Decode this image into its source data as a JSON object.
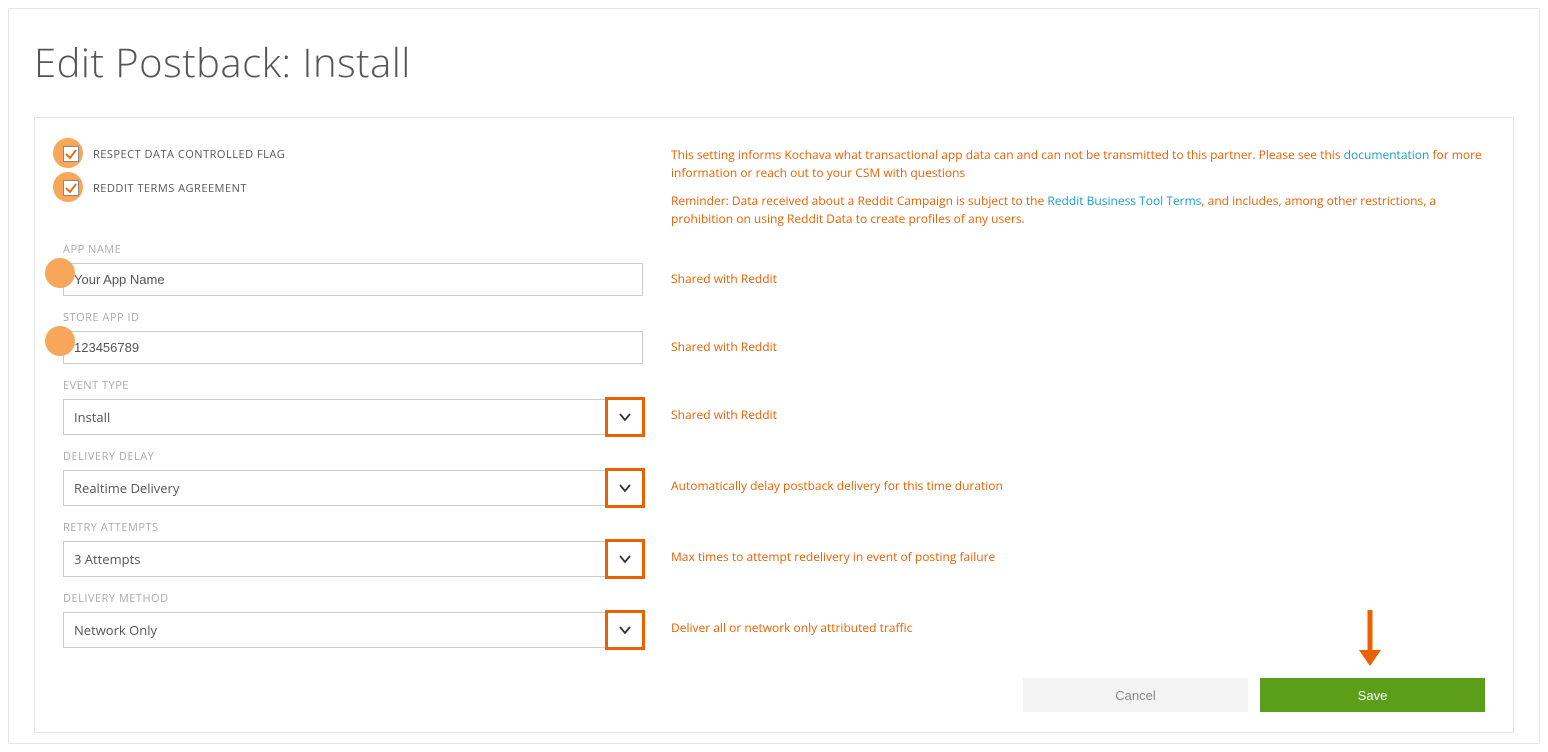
{
  "pageTitle": "Edit Postback: Install",
  "checkboxes": {
    "respect": {
      "label": "RESPECT DATA CONTROLLED FLAG",
      "checked": true
    },
    "terms": {
      "label": "REDDIT TERMS AGREEMENT",
      "checked": true
    }
  },
  "info": {
    "line1_pre": "This setting informs Kochava what transactional app data can and can not be transmitted to this partner. Please see this ",
    "line1_link": "documentation",
    "line1_post": " for more information or reach out to your CSM with questions",
    "line2_pre": "Reminder: Data received about a Reddit Campaign is subject to the ",
    "line2_link": "Reddit Business Tool Terms",
    "line2_post": ", and includes, among other restrictions, a prohibition on using Reddit Data to create profiles of any users."
  },
  "fields": {
    "appName": {
      "label": "APP NAME",
      "value": "Your App Name",
      "help": "Shared with Reddit"
    },
    "storeId": {
      "label": "STORE APP ID",
      "value": "123456789",
      "help": "Shared with Reddit"
    },
    "eventType": {
      "label": "EVENT TYPE",
      "value": "Install",
      "help": "Shared with Reddit"
    },
    "delay": {
      "label": "DELIVERY DELAY",
      "value": "Realtime Delivery",
      "help": "Automatically delay postback delivery for this time duration"
    },
    "retry": {
      "label": "RETRY ATTEMPTS",
      "value": "3 Attempts",
      "help": "Max times to attempt redelivery in event of posting failure"
    },
    "method": {
      "label": "DELIVERY METHOD",
      "value": "Network Only",
      "help": "Deliver all or network only attributed traffic"
    }
  },
  "buttons": {
    "cancel": "Cancel",
    "save": "Save"
  },
  "markerColor": "#eb6100",
  "circleColor": "#f7a65a"
}
